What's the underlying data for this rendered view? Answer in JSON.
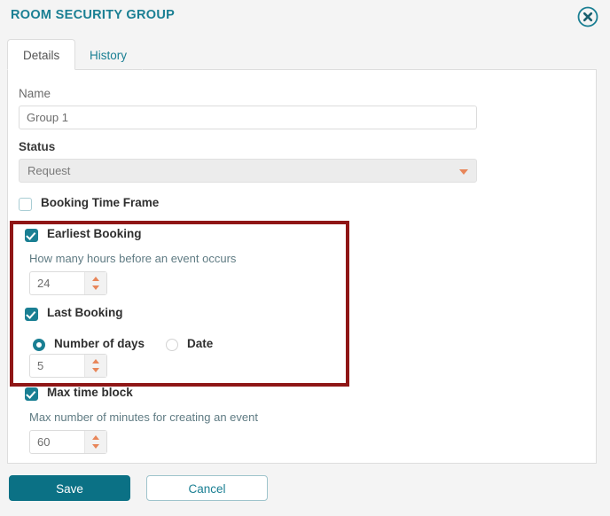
{
  "header": {
    "title": "ROOM SECURITY GROUP",
    "close_icon": "close-circle-icon"
  },
  "tabs": [
    {
      "label": "Details",
      "active": true
    },
    {
      "label": "History",
      "active": false
    }
  ],
  "form": {
    "name": {
      "label": "Name",
      "value": "Group 1"
    },
    "status": {
      "label": "Status",
      "value": "Request",
      "caret_icon": "caret-down-icon"
    },
    "booking_time_frame": {
      "label": "Booking Time Frame",
      "checked": false
    },
    "earliest_booking": {
      "label": "Earliest Booking",
      "checked": true,
      "hint": "How many hours before an event occurs",
      "value": "24"
    },
    "last_booking": {
      "label": "Last Booking",
      "checked": true,
      "options": [
        {
          "label": "Number of days",
          "selected": true
        },
        {
          "label": "Date",
          "selected": false
        }
      ],
      "value": "5"
    },
    "max_time_block": {
      "label": "Max time block",
      "checked": true,
      "hint": "Max number of minutes for creating an event",
      "value": "60"
    }
  },
  "footer": {
    "save_label": "Save",
    "cancel_label": "Cancel"
  },
  "colors": {
    "accent_teal": "#1a7f93",
    "save_button": "#0b7185",
    "spinner_orange": "#e8865a",
    "highlight_red": "#8f1616",
    "page_background": "#f4f4f4"
  }
}
